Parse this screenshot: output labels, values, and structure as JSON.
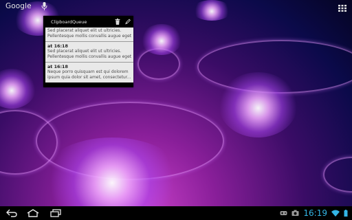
{
  "google_search": {
    "logo_text": "Google",
    "icon": "mic-icon"
  },
  "widget": {
    "title": "ClipboardQueue",
    "actions": [
      "trash-icon",
      "edit-icon"
    ],
    "items": [
      {
        "time": "",
        "lines": [
          "Sed placerat aliquet elit ut ultricies.",
          "Pellentesque mollis convallis augue eget..."
        ]
      },
      {
        "time": "at 16:18",
        "lines": [
          "Sed placerat aliquet elit ut ultricies.",
          "Pellentesque mollis convallis augue eget..."
        ]
      },
      {
        "time": "at 16:18",
        "lines": [
          "Neque porro quisquam est qui dolorem",
          "ipsum quia dolor sit amet, consectetur..."
        ]
      }
    ]
  },
  "status_bar": {
    "clock": "16:19",
    "accent_color": "#33b5e5",
    "icons": [
      "game-icon",
      "screenshot-icon",
      "wifi-icon",
      "battery-icon"
    ]
  },
  "nav": {
    "buttons": [
      "back-icon",
      "home-icon",
      "recent-apps-icon"
    ]
  }
}
